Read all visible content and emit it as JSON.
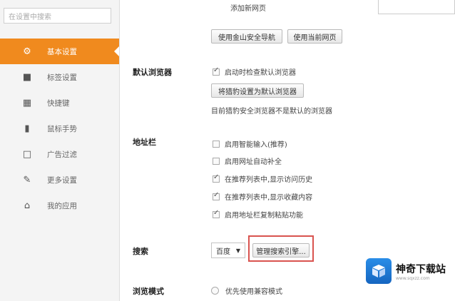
{
  "sidebar": {
    "search_placeholder": "在设置中搜索",
    "items": [
      {
        "label": "基本设置",
        "icon": "gear-icon",
        "active": true
      },
      {
        "label": "标签设置",
        "icon": "square-icon"
      },
      {
        "label": "快捷键",
        "icon": "keyboard-icon"
      },
      {
        "label": "鼠标手势",
        "icon": "mouse-icon"
      },
      {
        "label": "广告过滤",
        "icon": "window-icon"
      },
      {
        "label": "更多设置",
        "icon": "wrench-icon"
      },
      {
        "label": "我的应用",
        "icon": "home-icon"
      }
    ]
  },
  "main": {
    "add_new_page": "添加新网页",
    "btn_kingsoft_nav": "使用金山安全导航",
    "btn_current_page": "使用当前网页",
    "default_browser": {
      "label": "默认浏览器",
      "check_on_start": "启动时检查默认浏览器",
      "set_default_btn": "将猎豹设置为默认浏览器",
      "status_text": "目前猎豹安全浏览器不是默认的浏览器"
    },
    "address_bar": {
      "label": "地址栏",
      "options": [
        {
          "text": "启用智能输入(推荐)",
          "checked": false
        },
        {
          "text": "启用网址自动补全",
          "checked": false
        },
        {
          "text": "在推荐列表中,显示访问历史",
          "checked": true
        },
        {
          "text": "在推荐列表中,显示收藏内容",
          "checked": true
        },
        {
          "text": "启用地址栏复制粘贴功能",
          "checked": true
        }
      ]
    },
    "search": {
      "label": "搜索",
      "engine": "百度",
      "manage_btn": "管理搜索引擎..."
    },
    "browse_mode": {
      "label": "浏览模式",
      "option": "优先使用兼容模式"
    }
  },
  "watermark": {
    "title": "神奇下载站",
    "url": "www.sqxzz.com"
  },
  "colors": {
    "accent": "#f08a1e",
    "highlight": "#d9534f"
  }
}
